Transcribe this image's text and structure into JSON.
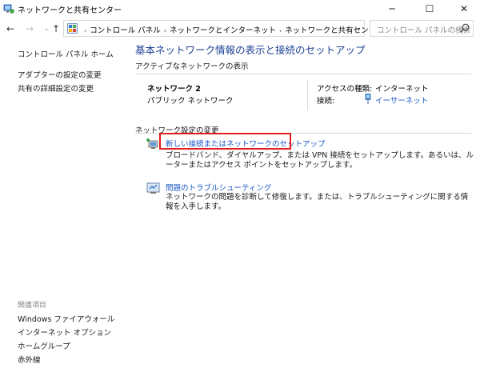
{
  "window": {
    "title": "ネットワークと共有センター",
    "minimize_glyph": "─",
    "maximize_glyph": "☐",
    "close_glyph": "✕"
  },
  "nav": {
    "back_glyph": "←",
    "forward_glyph": "→",
    "recent_glyph": "⌄",
    "up_glyph": "↑",
    "refresh_glyph": "↻",
    "address_dropdown_glyph": "⌄",
    "breadcrumbs": [
      "コントロール パネル",
      "ネットワークとインターネット",
      "ネットワークと共有センター"
    ],
    "separator": "›",
    "search_placeholder": "コントロール パネルの検索"
  },
  "sidebar": {
    "home": "コントロール パネル ホーム",
    "links": [
      "アダプターの設定の変更",
      "共有の詳細設定の変更"
    ],
    "related_header": "関連項目",
    "related": [
      "Windows ファイアウォール",
      "インターネット オプション",
      "ホームグループ",
      "赤外線"
    ]
  },
  "main": {
    "title": "基本ネットワーク情報の表示と接続のセットアップ",
    "active_networks_label": "アクティブなネットワークの表示",
    "network": {
      "name": "ネットワーク 2",
      "type": "パブリック ネットワーク",
      "access_type_label": "アクセスの種類:",
      "access_type_value": "インターネット",
      "connections_label": "接続:",
      "connections_value": "イーサーネット"
    },
    "change_settings_label": "ネットワーク設定の変更",
    "tasks": [
      {
        "link": "新しい接続またはネットワークのセットアップ",
        "desc": "ブロードバンド、ダイヤルアップ、または VPN 接続をセットアップします。あるいは、ルーターまたはアクセス ポイントをセットアップします。"
      },
      {
        "link": "問題のトラブルシューティング",
        "desc": "ネットワークの問題を診断して修復します。または、トラブルシューティングに関する情報を入手します。"
      }
    ]
  },
  "colors": {
    "link": "#1a56c4",
    "title": "#1c3f94",
    "highlight": "#e51c1c"
  }
}
